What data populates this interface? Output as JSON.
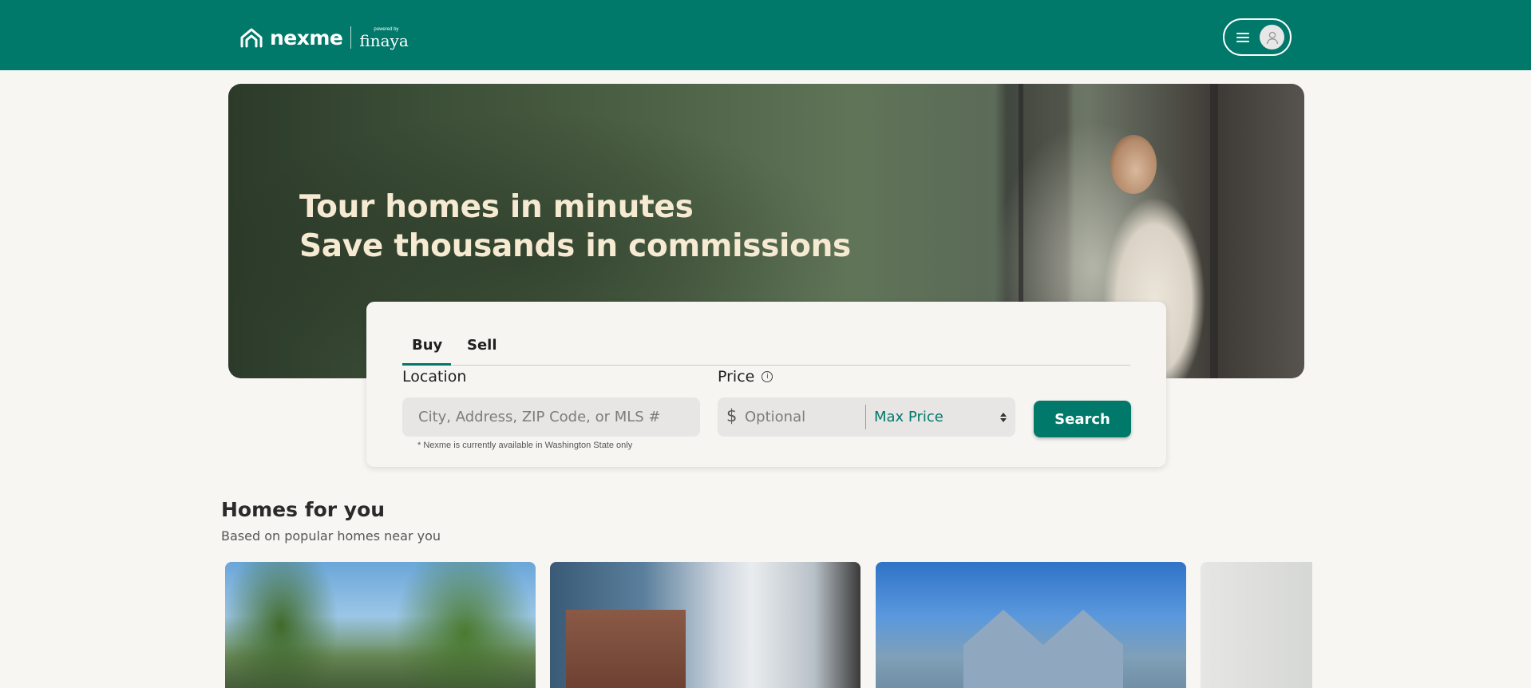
{
  "header": {
    "brand_name": "nexme",
    "partner_powered": "powered by",
    "partner_name": "finaya"
  },
  "hero": {
    "title_line1": "Tour homes in minutes",
    "title_line2": "Save thousands in commissions"
  },
  "search": {
    "tabs": [
      {
        "label": "Buy",
        "active": true
      },
      {
        "label": "Sell",
        "active": false
      }
    ],
    "location_label": "Location",
    "location_placeholder": "City, Address, ZIP Code, or MLS #",
    "availability_note": "* Nexme is currently available in Washington State only",
    "price_label": "Price",
    "currency_symbol": "$",
    "min_price_placeholder": "Optional",
    "max_price_selected": "Max Price",
    "search_button": "Search"
  },
  "homes_section": {
    "title": "Homes for you",
    "subtitle": "Based on popular homes near you"
  },
  "colors": {
    "brand": "#00786a",
    "hero_text": "#f6ead2",
    "page_bg": "#f7f6f3"
  }
}
